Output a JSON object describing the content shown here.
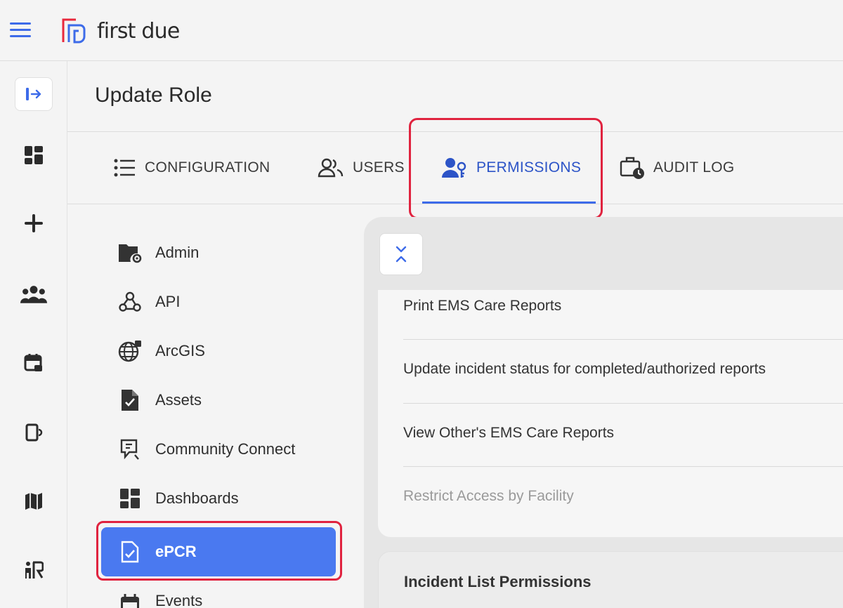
{
  "app": {
    "logo_text": "first due"
  },
  "page": {
    "title": "Update Role"
  },
  "tabs": [
    {
      "label": "CONFIGURATION",
      "icon": "list-icon"
    },
    {
      "label": "USERS",
      "icon": "users-icon"
    },
    {
      "label": "PERMISSIONS",
      "icon": "user-key-icon",
      "active": true
    },
    {
      "label": "AUDIT LOG",
      "icon": "briefcase-clock-icon"
    }
  ],
  "rail": [
    "collapse-arrow-icon",
    "dashboard-icon",
    "plus-icon",
    "people-icon",
    "calendar-icon",
    "device-icon",
    "map-icon",
    "reader-icon"
  ],
  "modules": [
    {
      "label": "Admin",
      "icon": "folder-gear-icon"
    },
    {
      "label": "API",
      "icon": "webhook-icon"
    },
    {
      "label": "ArcGIS",
      "icon": "globe-icon"
    },
    {
      "label": "Assets",
      "icon": "file-check-icon"
    },
    {
      "label": "Community Connect",
      "icon": "community-connect-icon"
    },
    {
      "label": "Dashboards",
      "icon": "dashboard-icon"
    },
    {
      "label": "ePCR",
      "icon": "clipboard-check-icon",
      "active": true
    },
    {
      "label": "Events",
      "icon": "calendar-icon"
    }
  ],
  "permissions": [
    {
      "label": "Print EMS Care Reports",
      "enabled": true
    },
    {
      "label": "Update incident status for completed/authorized reports",
      "enabled": true
    },
    {
      "label": "View Other's EMS Care Reports",
      "enabled": true
    },
    {
      "label": "Restrict Access by Facility",
      "enabled": false
    }
  ],
  "section": {
    "title": "Incident List Permissions"
  },
  "colors": {
    "accent": "#3d6be9",
    "highlight": "#e0233f",
    "active_module": "#4a79f0"
  }
}
